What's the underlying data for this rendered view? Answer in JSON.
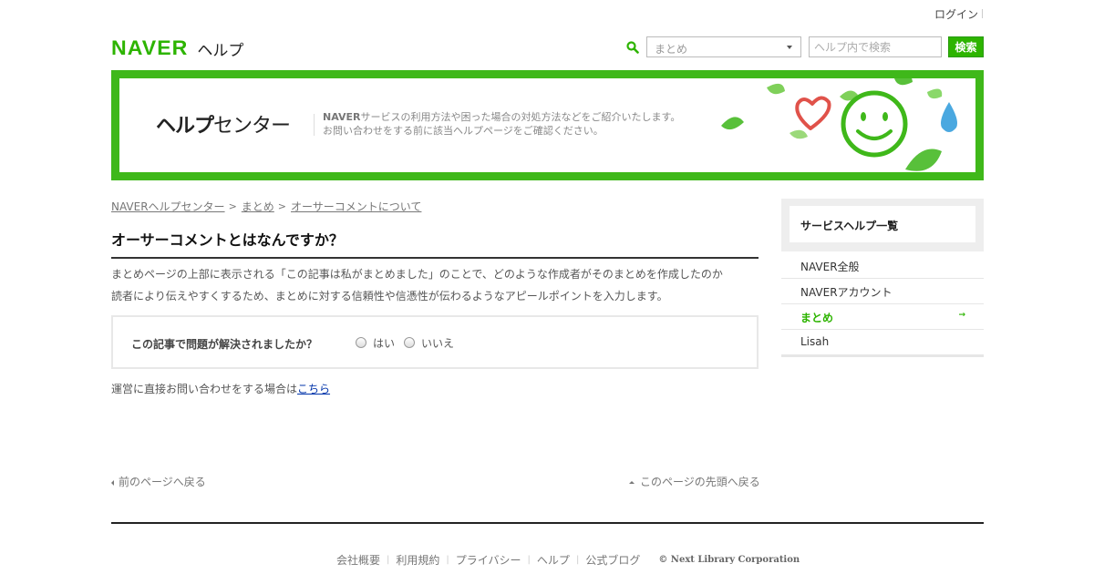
{
  "header": {
    "login": "ログイン",
    "logo_text": "NAVER",
    "help_label": "ヘルプ",
    "select_value": "まとめ",
    "search_placeholder": "ヘルプ内で検索",
    "search_button": "検索"
  },
  "banner": {
    "title_bold": "ヘルプ",
    "title_rest": "センター",
    "desc_brand": "NAVER",
    "desc_line1": "サービスの利用方法や困った場合の対処方法などをご紹介いたします。",
    "desc_line2": "お問い合わせをする前に該当ヘルプページをご確認ください。"
  },
  "breadcrumb": [
    "NAVERヘルプセンター",
    "まとめ",
    "オーサーコメントについて"
  ],
  "article": {
    "title": "オーサーコメントとはなんですか？",
    "body_line1": "まとめページの上部に表示される「この記事は私がまとめました」のことで、どのような作成者がそのまとめを作成したのか",
    "body_line2": "読者により伝えやすくするため、まとめに対する信頼性や信憑性が伝わるようなアピールポイントを入力します。"
  },
  "feedback": {
    "question": "この記事で問題が解決されましたか？",
    "yes": "はい",
    "no": "いいえ"
  },
  "contact": {
    "text": "運営に直接お問い合わせをする場合は",
    "link": "こちら"
  },
  "nav": {
    "prev": "前のページへ戻る",
    "top": "このページの先頭へ戻る"
  },
  "sidebar": {
    "title": "サービスヘルプ一覧",
    "items": [
      {
        "label": "NAVER全般"
      },
      {
        "label": "NAVERアカウント"
      },
      {
        "label": "まとめ",
        "active": true
      },
      {
        "label": "Lisah"
      }
    ]
  },
  "footer": {
    "links": [
      "会社概要",
      "利用規約",
      "プライバシー",
      "ヘルプ",
      "公式ブログ"
    ],
    "copyright": "© Next Library Corporation"
  },
  "colors": {
    "brand_green": "#2db400",
    "banner_green": "#3fb81a",
    "link_blue": "#0033aa"
  },
  "icons": [
    "search-icon",
    "caret-down-icon",
    "heart-icon",
    "smiley-icon",
    "water-drop-icon",
    "leaf-icon",
    "arrow-right-icon",
    "triangle-left-icon",
    "triangle-up-icon"
  ]
}
